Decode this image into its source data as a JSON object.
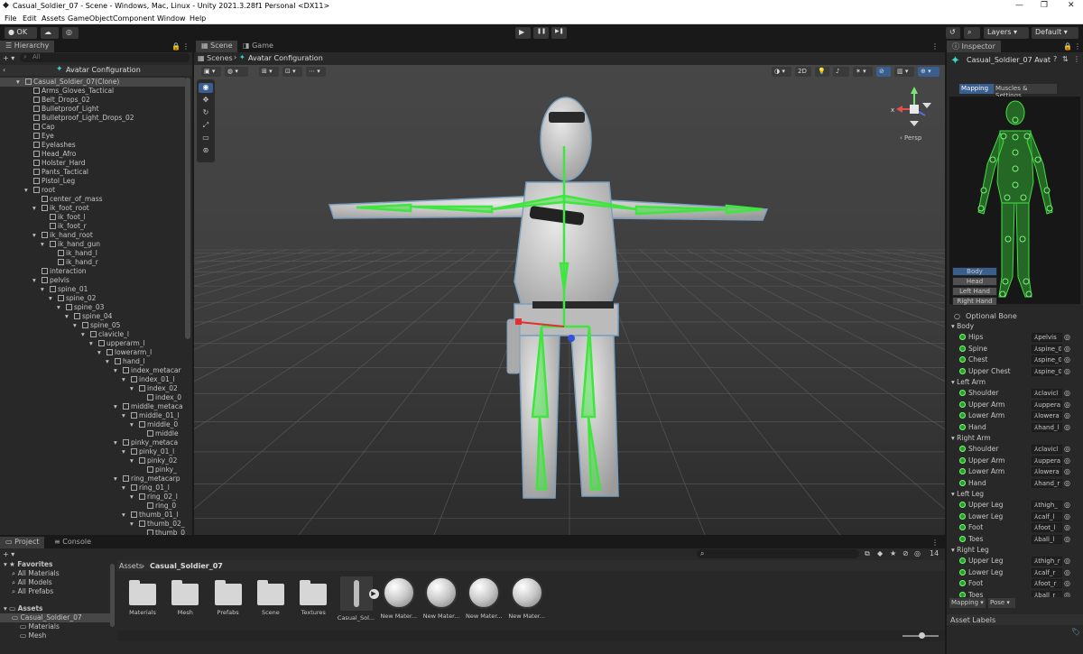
{
  "window": {
    "title": "Casual_Soldier_07 - Scene - Windows, Mac, Linux - Unity 2021.3.28f1 Personal <DX11>",
    "min": "—",
    "max": "❐",
    "close": "✕"
  },
  "menu": [
    "File",
    "Edit",
    "Assets",
    "GameObject",
    "Component",
    "Window",
    "Help"
  ],
  "toolbar": {
    "account": "OK",
    "layers": "Layers",
    "layout": "Default",
    "play": "▶",
    "pause": "❚❚",
    "step": "▶❚"
  },
  "hierarchy": {
    "tab": "Hierarchy",
    "search_placeholder": "All",
    "context": "Avatar Configuration",
    "items": [
      {
        "label": "Casual_Soldier_07(Clone)",
        "d": 0,
        "sel": true
      },
      {
        "label": "Arms_Gloves_Tactical",
        "d": 1
      },
      {
        "label": "Belt_Drops_02",
        "d": 1
      },
      {
        "label": "Bulletproof_Light",
        "d": 1
      },
      {
        "label": "Bulletproof_Light_Drops_02",
        "d": 1
      },
      {
        "label": "Cap",
        "d": 1
      },
      {
        "label": "Eye",
        "d": 1
      },
      {
        "label": "Eyelashes",
        "d": 1
      },
      {
        "label": "Head_Afro",
        "d": 1
      },
      {
        "label": "Holster_Hard",
        "d": 1
      },
      {
        "label": "Pants_Tactical",
        "d": 1
      },
      {
        "label": "Pistol_Leg",
        "d": 1
      },
      {
        "label": "root",
        "d": 1
      },
      {
        "label": "center_of_mass",
        "d": 2
      },
      {
        "label": "ik_foot_root",
        "d": 2
      },
      {
        "label": "ik_foot_l",
        "d": 3
      },
      {
        "label": "ik_foot_r",
        "d": 3
      },
      {
        "label": "ik_hand_root",
        "d": 2
      },
      {
        "label": "ik_hand_gun",
        "d": 3
      },
      {
        "label": "ik_hand_l",
        "d": 4
      },
      {
        "label": "ik_hand_r",
        "d": 4
      },
      {
        "label": "interaction",
        "d": 2
      },
      {
        "label": "pelvis",
        "d": 2
      },
      {
        "label": "spine_01",
        "d": 3
      },
      {
        "label": "spine_02",
        "d": 4
      },
      {
        "label": "spine_03",
        "d": 5
      },
      {
        "label": "spine_04",
        "d": 6
      },
      {
        "label": "spine_05",
        "d": 7
      },
      {
        "label": "clavicle_l",
        "d": 8
      },
      {
        "label": "upperarm_l",
        "d": 9
      },
      {
        "label": "lowerarm_l",
        "d": 10
      },
      {
        "label": "hand_l",
        "d": 11
      },
      {
        "label": "index_metacar",
        "d": 12
      },
      {
        "label": "index_01_l",
        "d": 13
      },
      {
        "label": "index_02",
        "d": 14
      },
      {
        "label": "index_0",
        "d": 15
      },
      {
        "label": "middle_metaca",
        "d": 12
      },
      {
        "label": "middle_01_l",
        "d": 13
      },
      {
        "label": "middle_0",
        "d": 14
      },
      {
        "label": "middle",
        "d": 15
      },
      {
        "label": "pinky_metaca",
        "d": 12
      },
      {
        "label": "pinky_01_l",
        "d": 13
      },
      {
        "label": "pinky_02",
        "d": 14
      },
      {
        "label": "pinky_",
        "d": 15
      },
      {
        "label": "ring_metacarp",
        "d": 12
      },
      {
        "label": "ring_01_l",
        "d": 13
      },
      {
        "label": "ring_02_l",
        "d": 14
      },
      {
        "label": "ring_0",
        "d": 15
      },
      {
        "label": "thumb_01_l",
        "d": 13
      },
      {
        "label": "thumb_02_l",
        "d": 14
      },
      {
        "label": "thumb_0",
        "d": 15
      }
    ]
  },
  "scene": {
    "tab_scene": "Scene",
    "tab_game": "Game",
    "breadcrumb_root": "Scenes",
    "breadcrumb_ctx": "Avatar Configuration",
    "btn_2d": "2D",
    "persp": "Persp",
    "gizmo_x": "x"
  },
  "inspector": {
    "tab": "Inspector",
    "object": "Casual_Soldier_07 Avat",
    "tab_mapping": "Mapping",
    "tab_muscles": "Muscles & Settings",
    "body_tabs": [
      "Body",
      "Head",
      "Left Hand",
      "Right Hand"
    ],
    "optional": "Optional Bone",
    "groups": [
      {
        "name": "Body",
        "rows": [
          [
            "Hips",
            "pelvis"
          ],
          [
            "Spine",
            "spine_0"
          ],
          [
            "Chest",
            "spine_0"
          ],
          [
            "Upper Chest",
            "spine_0"
          ]
        ]
      },
      {
        "name": "Left Arm",
        "rows": [
          [
            "Shoulder",
            "clavicl"
          ],
          [
            "Upper Arm",
            "uppera"
          ],
          [
            "Lower Arm",
            "lowera"
          ],
          [
            "Hand",
            "hand_l"
          ]
        ]
      },
      {
        "name": "Right Arm",
        "rows": [
          [
            "Shoulder",
            "clavicl"
          ],
          [
            "Upper Arm",
            "uppera"
          ],
          [
            "Lower Arm",
            "lowera"
          ],
          [
            "Hand",
            "hand_r"
          ]
        ]
      },
      {
        "name": "Left Leg",
        "rows": [
          [
            "Upper Leg",
            "thigh_"
          ],
          [
            "Lower Leg",
            "calf_l"
          ],
          [
            "Foot",
            "foot_l"
          ],
          [
            "Toes",
            "ball_l"
          ]
        ]
      },
      {
        "name": "Right Leg",
        "rows": [
          [
            "Upper Leg",
            "thigh_r"
          ],
          [
            "Lower Leg",
            "calf_r"
          ],
          [
            "Foot",
            "foot_r"
          ],
          [
            "Toes",
            "ball_r"
          ]
        ]
      }
    ],
    "mapping_btn": "Mapping ▾",
    "pose_btn": "Pose ▾",
    "asset_labels": "Asset Labels"
  },
  "project": {
    "tab_project": "Project",
    "tab_console": "Console",
    "breadcrumb": [
      "Assets",
      "Casual_Soldier_07"
    ],
    "badge": "14",
    "tree": [
      {
        "label": "Favorites",
        "d": 0,
        "bold": true
      },
      {
        "label": "All Materials",
        "d": 1
      },
      {
        "label": "All Models",
        "d": 1
      },
      {
        "label": "All Prefabs",
        "d": 1
      },
      {
        "label": "Assets",
        "d": 0,
        "bold": true
      },
      {
        "label": "Casual_Soldier_07",
        "d": 1,
        "sel": true
      },
      {
        "label": "Materials",
        "d": 2
      },
      {
        "label": "Mesh",
        "d": 2
      }
    ],
    "assets": [
      {
        "label": "Materials",
        "kind": "folder"
      },
      {
        "label": "Mesh",
        "kind": "folder"
      },
      {
        "label": "Prefabs",
        "kind": "folder"
      },
      {
        "label": "Scene",
        "kind": "folder"
      },
      {
        "label": "Textures",
        "kind": "folder"
      },
      {
        "label": "Casual_Sol...",
        "kind": "model"
      },
      {
        "label": "New Mater...",
        "kind": "sphere"
      },
      {
        "label": "New Mater...",
        "kind": "sphere"
      },
      {
        "label": "New Mater...",
        "kind": "sphere"
      },
      {
        "label": "New Mater...",
        "kind": "sphere"
      }
    ]
  },
  "colors": {
    "bone_green": "#3ee63e",
    "selected_blue": "#3a5f8f",
    "editor_bg": "#282828"
  }
}
